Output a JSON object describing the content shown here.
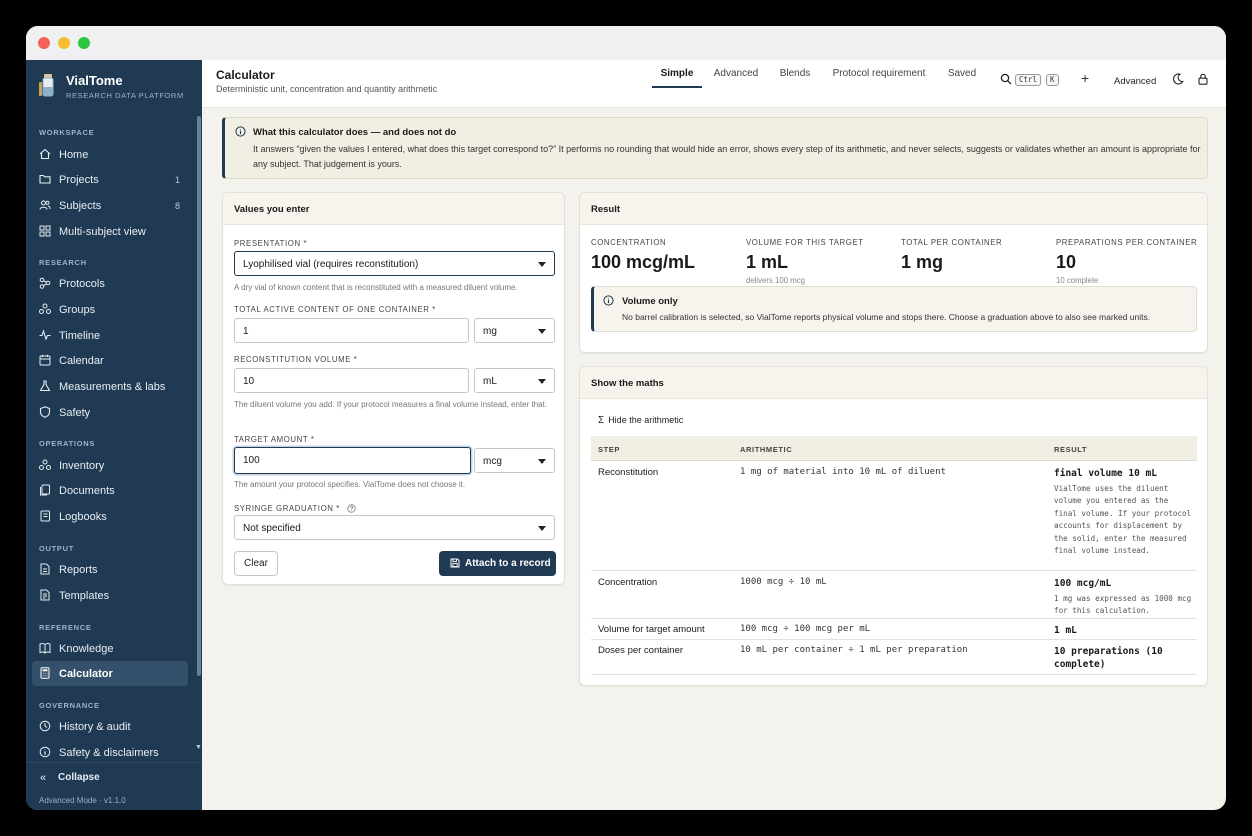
{
  "window": {
    "traffic_lights": [
      "close",
      "minimize",
      "zoom"
    ]
  },
  "sidebar": {
    "brand_name": "VialTome",
    "brand_sub": "RESEARCH DATA PLATFORM",
    "sections": {
      "workspace": "WORKSPACE",
      "research": "RESEARCH",
      "operations": "OPERATIONS",
      "output": "OUTPUT",
      "reference": "REFERENCE",
      "governance": "GOVERNANCE"
    },
    "items": {
      "home": {
        "label": "Home",
        "icon": "home-icon"
      },
      "projects": {
        "label": "Projects",
        "count": "1",
        "icon": "folder-icon"
      },
      "subjects": {
        "label": "Subjects",
        "count": "8",
        "icon": "users-icon"
      },
      "multi_subject": {
        "label": "Multi-subject view",
        "icon": "grid-icon"
      },
      "protocols": {
        "label": "Protocols",
        "icon": "molecule-icon"
      },
      "groups": {
        "label": "Groups",
        "icon": "groups-icon"
      },
      "timeline": {
        "label": "Timeline",
        "icon": "pulse-icon"
      },
      "calendar": {
        "label": "Calendar",
        "icon": "calendar-icon"
      },
      "measurements": {
        "label": "Measurements & labs",
        "icon": "flask-icon"
      },
      "safety": {
        "label": "Safety",
        "icon": "shield-icon"
      },
      "inventory": {
        "label": "Inventory",
        "icon": "inventory-icon"
      },
      "documents": {
        "label": "Documents",
        "icon": "documents-icon"
      },
      "logbooks": {
        "label": "Logbooks",
        "icon": "logbook-icon"
      },
      "reports": {
        "label": "Reports",
        "icon": "reports-icon"
      },
      "templates": {
        "label": "Templates",
        "icon": "templates-icon"
      },
      "knowledge": {
        "label": "Knowledge",
        "icon": "book-icon"
      },
      "calculator": {
        "label": "Calculator",
        "icon": "calculator-icon"
      },
      "history": {
        "label": "History & audit",
        "icon": "history-icon"
      },
      "disclaimers": {
        "label": "Safety & disclaimers",
        "icon": "info-icon"
      }
    },
    "collapse_label": "Collapse",
    "version": "Advanced Mode · v1.1.0"
  },
  "header": {
    "title": "Calculator",
    "subtitle": "Deterministic unit, concentration and quantity arithmetic",
    "tabs": [
      "Simple",
      "Advanced",
      "Blends",
      "Protocol requirement",
      "Saved"
    ],
    "active_tab": "Simple",
    "kbd_ctrl": "Ctrl",
    "kbd_k": "K",
    "plus": "+",
    "mode_label": "Advanced"
  },
  "banner": {
    "title": "What this calculator does — and does not do",
    "text": "It answers “given the values I entered, what does this target correspond to?” It performs no rounding that would hide an error, shows every step of its arithmetic, and never selects, suggests or validates whether an amount is appropriate for any subject. That judgement is yours."
  },
  "inputs": {
    "card_title": "Values you enter",
    "presentation_label": "PRESENTATION *",
    "presentation_value": "Lyophilised vial (requires reconstitution)",
    "presentation_help": "A dry vial of known content that is reconstituted with a measured diluent volume.",
    "content_label": "TOTAL ACTIVE CONTENT OF ONE CONTAINER *",
    "content_value": "1",
    "content_unit": "mg",
    "recon_label": "RECONSTITUTION VOLUME *",
    "recon_value": "10",
    "recon_unit": "mL",
    "recon_help": "The diluent volume you add. If your protocol measures a final volume instead, enter that.",
    "target_label": "TARGET AMOUNT *",
    "target_value": "100",
    "target_unit": "mcg",
    "target_help": "The amount your protocol specifies. VialTome does not choose it.",
    "syringe_label": "SYRINGE GRADUATION *",
    "syringe_value": "Not specified",
    "clear_label": "Clear",
    "attach_label": "Attach to a record"
  },
  "result": {
    "card_title": "Result",
    "concentration_label": "CONCENTRATION",
    "concentration_value": "100 mcg/mL",
    "volume_label": "VOLUME FOR THIS TARGET",
    "volume_value": "1 mL",
    "volume_sub": "delivers 100 mcg",
    "total_label": "TOTAL PER CONTAINER",
    "total_value": "1 mg",
    "preps_label": "PREPARATIONS PER CONTAINER",
    "preps_value": "10",
    "preps_sub": "10 complete",
    "note_title": "Volume only",
    "note_text": "No barrel calibration is selected, so VialTome reports physical volume and stops there. Choose a graduation above to also see marked units."
  },
  "maths": {
    "card_title": "Show the maths",
    "toggle_label": "Hide the arithmetic",
    "col_step": "STEP",
    "col_arith": "ARITHMETIC",
    "col_result": "RESULT",
    "rows": [
      {
        "step": "Reconstitution",
        "arith": "1 mg of material into 10 mL of diluent",
        "result": "final volume 10 mL",
        "note": "VialTome uses the diluent volume you entered as the final volume. If your protocol accounts for displacement by the solid, enter the measured final volume instead."
      },
      {
        "step": "Concentration",
        "arith": "1000 mcg ÷ 10 mL",
        "result": "100 mcg/mL",
        "note": "1 mg was expressed as 1000 mcg for this calculation."
      },
      {
        "step": "Volume for target amount",
        "arith": "100 mcg ÷ 100 mcg per mL",
        "result": "1 mL",
        "note": ""
      },
      {
        "step": "Doses per container",
        "arith": "10 mL per container ÷ 1 mL per preparation",
        "result": "10 preparations (10 complete)",
        "note": ""
      }
    ]
  },
  "colors": {
    "sidebar": "#1f3a52",
    "accent": "#1f3a52",
    "background": "#f4f2ec"
  }
}
